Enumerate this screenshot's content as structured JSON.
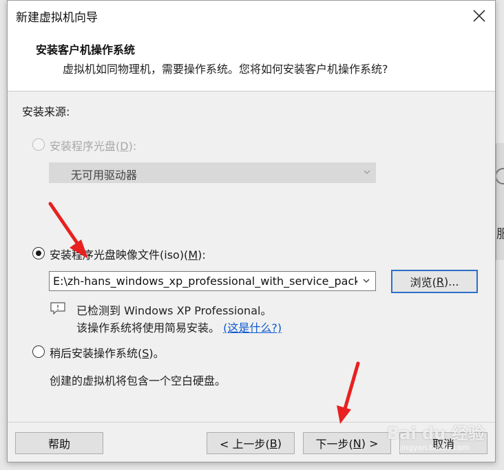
{
  "dialog": {
    "title": "新建虚拟机向导",
    "header_title": "安装客户机操作系统",
    "header_subtitle": "虚拟机如同物理机，需要操作系统。您将如何安装客户机操作系统?"
  },
  "install_source": {
    "label": "安装来源:",
    "disc_option": {
      "prefix": "安装程序光盘(",
      "key": "D",
      "suffix": "):",
      "selected": false,
      "enabled": false
    },
    "drive_select": {
      "value": "无可用驱动器"
    },
    "iso_option": {
      "prefix": "安装程序光盘映像文件(iso)(",
      "key": "M",
      "suffix": "):",
      "selected": true
    },
    "iso_path": {
      "value": "E:\\zh-hans_windows_xp_professional_with_service_pack"
    },
    "browse_button": {
      "prefix": "浏览(",
      "key": "R",
      "suffix": ")..."
    },
    "detected_text": "已检测到 Windows XP Professional。",
    "easy_install_text": "该操作系统将使用简易安装。",
    "help_link": "(这是什么?)",
    "later_option": {
      "prefix": "稍后安装操作系统(",
      "key": "S",
      "suffix": ")。",
      "selected": false
    },
    "later_desc": "创建的虚拟机将包含一个空白硬盘。"
  },
  "footer": {
    "help": "帮助",
    "back": {
      "prefix": "< 上一步(",
      "key": "B",
      "suffix": ")"
    },
    "next": {
      "prefix": "下一步(",
      "key": "N",
      "suffix": ") >"
    },
    "cancel": "取消"
  },
  "background": {
    "partial_text": "服"
  },
  "watermark": {
    "brand": "Bai du 经验",
    "url": "jingyan.baidu.com"
  },
  "annotation_color": "#e82020",
  "accent_color": "#2a6fc9",
  "link_color": "#0b57d0",
  "icons": [
    "close-icon",
    "chevron-down-icon",
    "info-icon",
    "red-arrow-icon"
  ]
}
